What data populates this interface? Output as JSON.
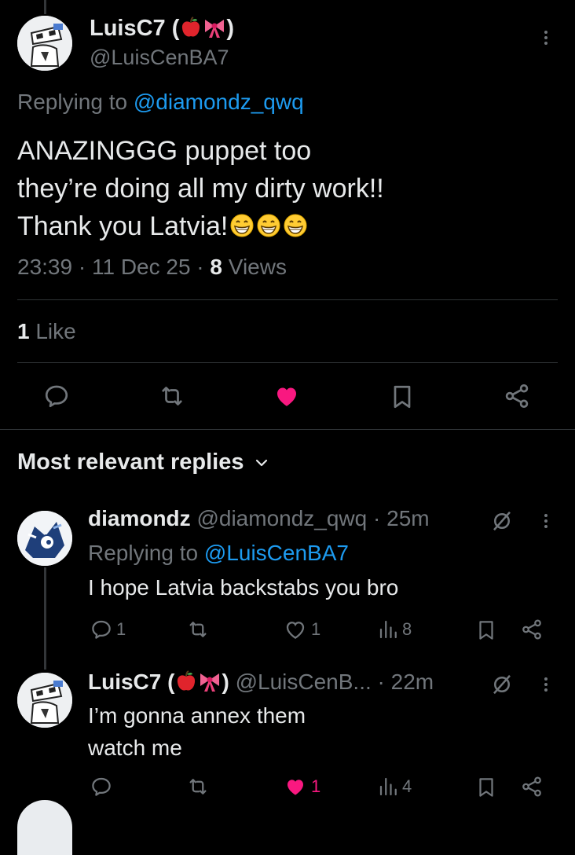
{
  "main_tweet": {
    "display_name": "LuisC7 (",
    "display_name_close": ")",
    "handle": "@LuisCenBA7",
    "replying_prefix": "Replying to ",
    "replying_to": "@diamondz_qwq",
    "text_line1": "ANAZINGGG puppet too",
    "text_line2": "they’re doing all my dirty work!!",
    "text_line3": "Thank you Latvia!",
    "time": "23:39",
    "sep1": " · ",
    "date": "11 Dec 25",
    "sep2": " · ",
    "views_count": "8",
    "views_label": " Views",
    "likes_count": "1",
    "likes_label": " Like"
  },
  "replies_header": {
    "label": "Most relevant replies"
  },
  "replies": [
    {
      "display_name": "diamondz",
      "handle": "@diamondz_qwq",
      "age": "· 25m",
      "replying_prefix": "Replying to ",
      "replying_to": "@LuisCenBA7",
      "text": "I hope Latvia backstabs you bro",
      "reply_count": "1",
      "like_count": "1",
      "views_count": "8"
    },
    {
      "display_name": "LuisC7 (",
      "display_name_close": ")",
      "handle": "@LuisCenB...",
      "age": "· 22m",
      "text_line1": "I’m gonna annex them",
      "text_line2": "watch me",
      "like_count": "1",
      "views_count": "4"
    }
  ],
  "colors": {
    "background": "#000000",
    "text": "#e7e9ea",
    "muted": "#71767b",
    "link": "#1d9bf0",
    "like_pink": "#f91880",
    "divider": "#2f3336"
  },
  "icons": [
    "more-icon",
    "reply-icon",
    "retweet-icon",
    "heart-icon",
    "bookmark-icon",
    "share-icon",
    "views-icon",
    "grok-icon",
    "chevron-down-icon",
    "apple-emoji",
    "bow-emoji",
    "grinning-emoji"
  ]
}
